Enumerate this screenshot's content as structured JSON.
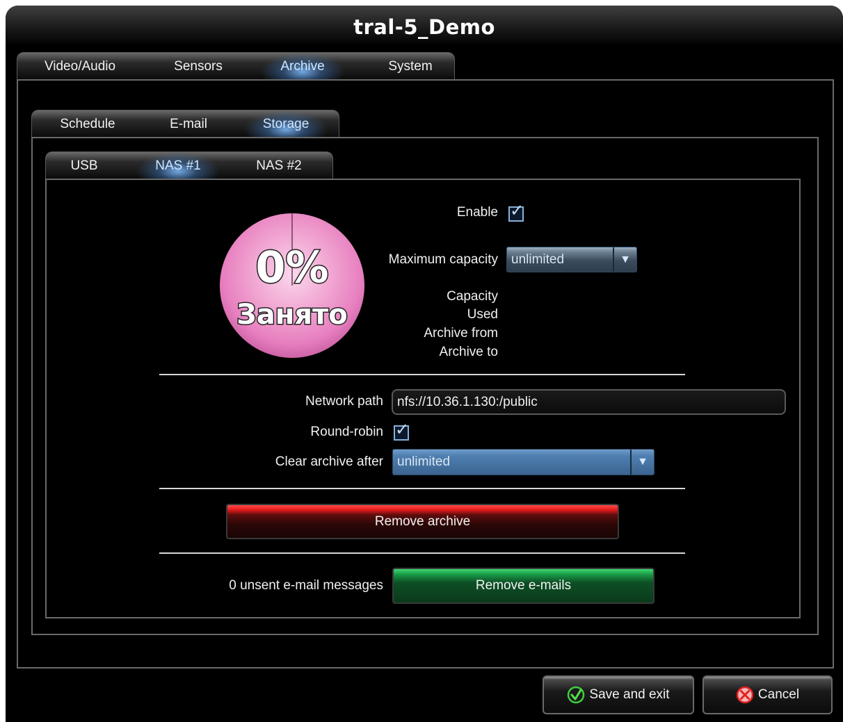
{
  "window": {
    "title": "tral-5_Demo"
  },
  "main_tabs": [
    "Video/Audio",
    "Sensors",
    "Archive",
    "System"
  ],
  "archive_tabs": [
    "Schedule",
    "E-mail",
    "Storage"
  ],
  "storage_tabs": [
    "USB",
    "NAS #1",
    "NAS #2"
  ],
  "usage": {
    "percent_label": "0%",
    "status_label": "Занято",
    "percent_used": 0,
    "color": "#e77fbf"
  },
  "form": {
    "enable_label": "Enable",
    "enable_checked": true,
    "max_capacity_label": "Maximum capacity",
    "max_capacity_value": "unlimited",
    "capacity_label": "Capacity",
    "used_label": "Used",
    "archive_from_label": "Archive from",
    "archive_to_label": "Archive to",
    "network_path_label": "Network path",
    "network_path_value": "nfs://10.36.1.130:/public",
    "round_robin_label": "Round-robin",
    "round_robin_checked": true,
    "clear_archive_label": "Clear archive after",
    "clear_archive_value": "unlimited"
  },
  "actions": {
    "remove_archive": "Remove archive",
    "unsent_messages": "0 unsent e-mail messages",
    "remove_emails": "Remove e-mails",
    "save_exit": "Save and exit",
    "cancel": "Cancel"
  },
  "colors": {
    "accent_blue": "#4f7fb0",
    "danger_red": "#e41b1b",
    "ok_green": "#1a9a48"
  },
  "icons": {
    "check": "checkmark-icon",
    "dropdown": "triangle-down-icon",
    "save": "green-check-circle-icon",
    "cancel": "red-cross-circle-icon"
  }
}
